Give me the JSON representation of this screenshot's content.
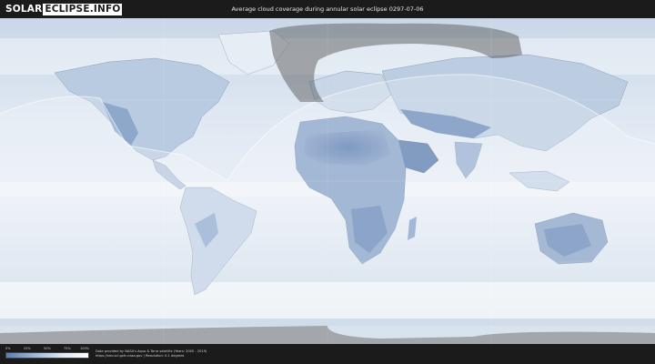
{
  "header": {
    "logo_solar": "SOLAR",
    "logo_eclipse": "ECLIPSE.INFO",
    "title": "Average cloud coverage during annular solar eclipse 0297-07-06"
  },
  "legend": {
    "ticks": [
      "0%",
      "25%",
      "50%",
      "75%",
      "100%"
    ],
    "colors": {
      "low": "#5e7fb0",
      "mid": "#dbe5f1",
      "high": "#ffffff"
    }
  },
  "credits": {
    "line1": "Data provided by NASA's Aqua & Terra satellite (Years: 2000 - 2019)",
    "line2": "https://neo.sci.gsfc.nasa.gov | Resolution: 0.1 degrees"
  },
  "map": {
    "ocean_color": "#d9e4ef",
    "land_clear_color": "#6f8dbb",
    "eclipse_zone_color": "#ffffff",
    "shadow_band_color": "#5a5a5a"
  }
}
